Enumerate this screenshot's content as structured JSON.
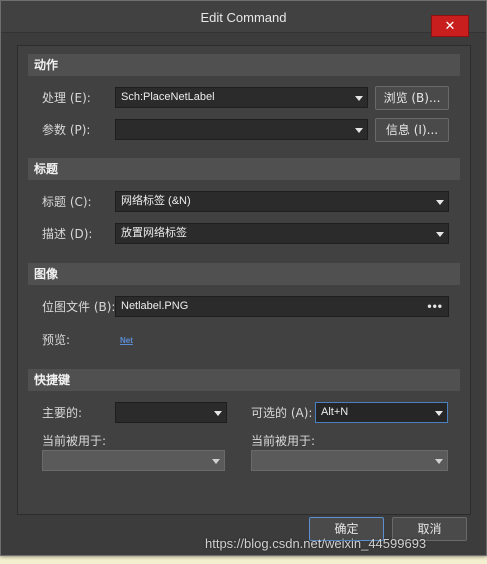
{
  "window": {
    "title": "Edit Command",
    "close_glyph": "✕"
  },
  "sections": {
    "action": "动作",
    "caption": "标题",
    "image": "图像",
    "shortcut": "快捷键"
  },
  "action": {
    "process_label": "处理 (E):",
    "process_value": "Sch:PlaceNetLabel",
    "browse_button": "浏览 (B)...",
    "params_label": "参数 (P):",
    "params_value": "",
    "info_button": "信息 (I)..."
  },
  "caption": {
    "title_label": "标题 (C):",
    "title_value": "网络标签 (&N)",
    "desc_label": "描述 (D):",
    "desc_value": "放置网络标签"
  },
  "image": {
    "bitmap_label": "位图文件 (B):",
    "bitmap_value": "Netlabel.PNG",
    "bitmap_dots": "•••",
    "preview_label": "预览:",
    "preview_text": "Net"
  },
  "shortcut": {
    "primary_label": "主要的:",
    "primary_value": "",
    "alternative_label": "可选的 (A):",
    "alternative_value": "Alt+N",
    "used_by_label_1": "当前被用于:",
    "used_by_value_1": "",
    "used_by_label_2": "当前被用于:",
    "used_by_value_2": ""
  },
  "footer": {
    "ok_button": "确定",
    "cancel_button": "取消",
    "watermark": "https://blog.csdn.net/weixin_44599693"
  },
  "colors": {
    "dialog_bg": "#3c3c3c",
    "section_bg": "#505050",
    "close_red": "#c81e1e",
    "focus_blue": "#4a7fc0"
  }
}
